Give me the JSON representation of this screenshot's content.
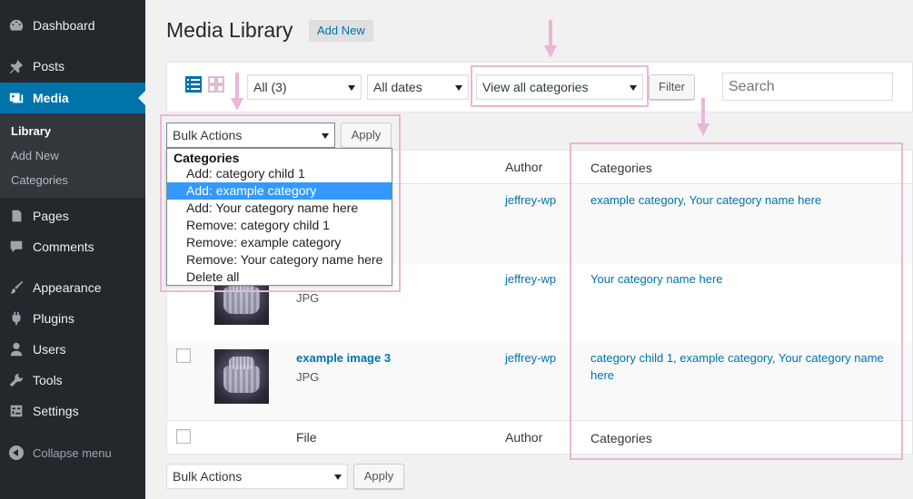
{
  "sidebar": {
    "items": [
      {
        "label": "Dashboard",
        "icon": "dashboard-icon"
      },
      {
        "label": "Posts",
        "icon": "pin-icon"
      },
      {
        "label": "Media",
        "icon": "media-icon"
      },
      {
        "label": "Pages",
        "icon": "page-icon"
      },
      {
        "label": "Comments",
        "icon": "comment-icon"
      },
      {
        "label": "Appearance",
        "icon": "brush-icon"
      },
      {
        "label": "Plugins",
        "icon": "plug-icon"
      },
      {
        "label": "Users",
        "icon": "user-icon"
      },
      {
        "label": "Tools",
        "icon": "wrench-icon"
      },
      {
        "label": "Settings",
        "icon": "settings-icon"
      }
    ],
    "submenu": [
      "Library",
      "Add New",
      "Categories"
    ],
    "collapse_label": "Collapse menu"
  },
  "header": {
    "title": "Media Library",
    "add_new": "Add New"
  },
  "filters": {
    "type_select": "All (3)",
    "date_select": "All dates",
    "category_select": "View all categories",
    "filter_button": "Filter",
    "search_placeholder": "Search"
  },
  "bulk_top": {
    "select": "Bulk Actions",
    "apply": "Apply"
  },
  "dropdown": {
    "group": "Categories",
    "options": [
      "Add: category child 1",
      "Add: example category",
      "Add: Your category name here",
      "Remove: category child 1",
      "Remove: example category",
      "Remove: Your category name here",
      "Delete all"
    ],
    "selected_index": 1
  },
  "table": {
    "headers": {
      "file": "File",
      "author": "Author",
      "categories": "Categories"
    },
    "rows": [
      {
        "title": "",
        "type": "",
        "author": "jeffrey-wp",
        "categories": "example category, Your category name here"
      },
      {
        "title": "",
        "type": "JPG",
        "author": "jeffrey-wp",
        "categories": "Your category name here"
      },
      {
        "title": "example image 3",
        "type": "JPG",
        "author": "jeffrey-wp",
        "categories": "category child 1, example category, Your category name here"
      }
    ]
  },
  "bulk_bottom": {
    "select": "Bulk Actions",
    "apply": "Apply"
  },
  "colors": {
    "sidebar_bg": "#23282d",
    "active": "#0073aa",
    "link": "#0073aa",
    "highlight": "#e8b7d8",
    "dropdown_selected": "#3399ff"
  }
}
